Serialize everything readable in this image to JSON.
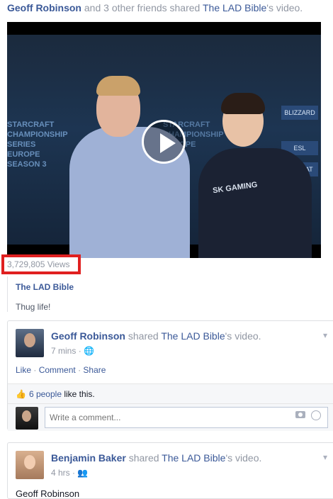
{
  "share_header": {
    "friend_name": "Geoff Robinson",
    "connector": "and 3 other friends shared",
    "page_name": "The LAD Bible",
    "suffix": "'s video."
  },
  "video": {
    "banner_text_left": "STARCRAFT\nCHAMPIONSHIP SERIES\nEUROPE\nSEASON 3",
    "sponsor_1": "BLIZZARD",
    "sponsor_2": "ESL",
    "sponsor_3": "ROCCAT",
    "shirt_logo": "SK GAMING",
    "play_icon": "play-icon"
  },
  "views_text": "3,729,805 Views",
  "source_name": "The LAD Bible",
  "caption": "Thug life!",
  "posts": [
    {
      "author": "Geoff Robinson",
      "action": "shared",
      "page_name": "The LAD Bible",
      "suffix": "'s video.",
      "time": "7 mins",
      "privacy_icon": "globe-icon",
      "actions": {
        "like": "Like",
        "comment": "Comment",
        "share": "Share"
      },
      "likes_count_text": "6 people",
      "likes_suffix": "like this.",
      "comment_placeholder": "Write a comment..."
    },
    {
      "author": "Benjamin Baker",
      "action": "shared",
      "page_name": "The LAD Bible",
      "suffix": "'s video.",
      "time": "4 hrs",
      "privacy_icon": "friends-icon",
      "peek_text": "Geoff Robinson"
    }
  ],
  "colors": {
    "link": "#3b5998",
    "highlight_box": "#e02020",
    "muted": "#9197a3"
  }
}
